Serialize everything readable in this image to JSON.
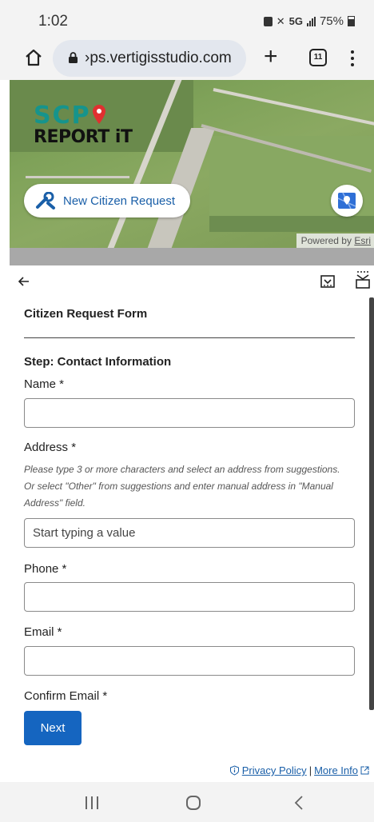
{
  "status_bar": {
    "time": "1:02",
    "network": "5G",
    "battery": "75%"
  },
  "browser": {
    "url": "›ps.vertigisstudio.com",
    "tab_count": "11",
    "home_icon": "home-icon",
    "lock_icon": "lock-icon",
    "new_tab_icon": "plus-icon",
    "menu_icon": "kebab-menu-icon"
  },
  "map": {
    "logo_top": "SCP",
    "logo_bottom": "REPORT iT",
    "new_request_label": "New Citizen Request",
    "powered_by": "Powered by",
    "powered_by_link": "Esri"
  },
  "panel": {
    "back_icon": "arrow-left-icon"
  },
  "form": {
    "title": "Citizen Request Form",
    "step": "Step: Contact Information",
    "fields": {
      "name": {
        "label": "Name  *",
        "value": "",
        "placeholder": ""
      },
      "address": {
        "label": "Address  *",
        "hint": "Please type 3 or more characters and select an address from suggestions. Or select \"Other\" from suggestions and enter manual address in \"Manual Address\" field.",
        "value": "",
        "placeholder": "Start typing a value"
      },
      "phone": {
        "label": "Phone  *",
        "value": "",
        "placeholder": ""
      },
      "email": {
        "label": "Email  *",
        "value": "",
        "placeholder": ""
      },
      "confirm_email": {
        "label": "Confirm Email  *"
      }
    },
    "next_label": "Next"
  },
  "footer": {
    "privacy": "Privacy Policy",
    "separator": "|",
    "more_info": "More Info"
  },
  "colors": {
    "primary": "#1565c0",
    "link": "#1a5fa8",
    "logo_teal": "#16948c",
    "logo_pin": "#e03030"
  }
}
